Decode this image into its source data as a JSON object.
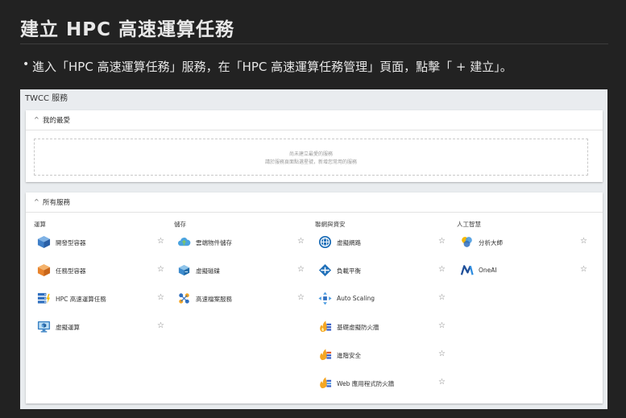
{
  "doc": {
    "title": "建立 HPC 高速運算任務",
    "step_bullet": "•",
    "step_text": "進入「HPC 高速運算任務」服務，在「HPC 高速運算任務管理」頁面，點擊「 + 建立」。"
  },
  "screenshot": {
    "title": "TWCC 服務",
    "favorites": {
      "header": "我的最愛",
      "caret": "^",
      "empty_line1": "尚未建立最愛的服務",
      "empty_line2": "請於服務頁面點選星號，新增您常用的服務"
    },
    "all_services": {
      "header": "所有服務",
      "caret": "^",
      "star_glyph": "☆",
      "columns": [
        {
          "title": "運算",
          "items": [
            {
              "label": "開發型容器",
              "icon": "cube-blue-icon"
            },
            {
              "label": "任務型容器",
              "icon": "cube-orange-icon"
            },
            {
              "label": "HPC 高速運算任務",
              "icon": "hpc-servers-icon"
            },
            {
              "label": "虛擬運算",
              "icon": "monitor-cube-icon"
            }
          ]
        },
        {
          "title": "儲存",
          "items": [
            {
              "label": "雲端物件儲存",
              "icon": "cloud-upload-icon"
            },
            {
              "label": "虛擬磁碟",
              "icon": "virtual-disk-icon"
            },
            {
              "label": "高速檔案服務",
              "icon": "file-system-icon"
            }
          ]
        },
        {
          "title": "聯網與資安",
          "items": [
            {
              "label": "虛擬網路",
              "icon": "virtual-network-icon"
            },
            {
              "label": "負載平衡",
              "icon": "load-balancer-icon"
            },
            {
              "label": "Auto Scaling",
              "icon": "auto-scaling-icon"
            },
            {
              "label": "基礎虛擬防火牆",
              "icon": "firewall-icon"
            },
            {
              "label": "進階安全",
              "icon": "advanced-security-icon"
            },
            {
              "label": "Web 應用程式防火牆",
              "icon": "waf-icon"
            }
          ]
        },
        {
          "title": "人工智慧",
          "items": [
            {
              "label": "分析大師",
              "icon": "analytics-icon"
            },
            {
              "label": "OneAI",
              "icon": "oneai-logo-icon"
            }
          ]
        }
      ]
    }
  }
}
